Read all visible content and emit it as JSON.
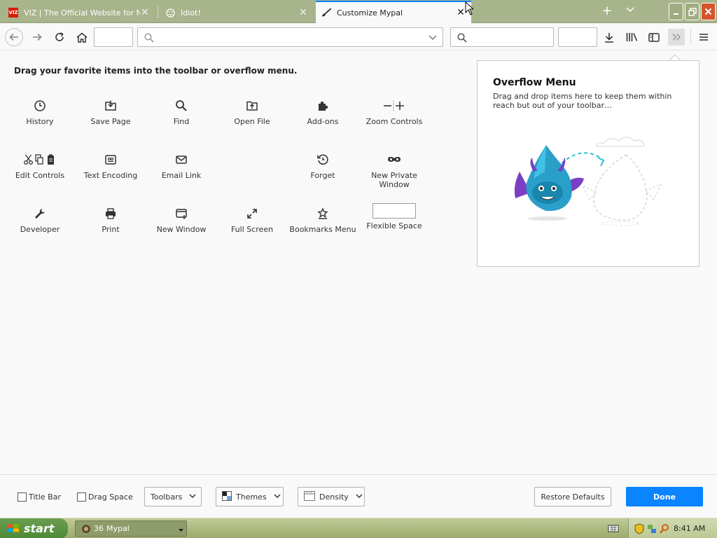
{
  "tabs": [
    {
      "title": "VIZ | The Official Website for Naruto",
      "favicon": "VIZ",
      "active": false
    },
    {
      "title": "Idiot!",
      "favicon": "smiley-icon",
      "active": false
    },
    {
      "title": "Customize Mypal",
      "favicon": "paintbrush-icon",
      "active": true
    }
  ],
  "toolbar": {
    "url_placeholder": "",
    "search_placeholder": ""
  },
  "instructions": "Drag your favorite items into the toolbar or overflow menu.",
  "palette": [
    {
      "label": "History",
      "icon": "clock-icon"
    },
    {
      "label": "Save Page",
      "icon": "save-page-icon"
    },
    {
      "label": "Find",
      "icon": "search-icon"
    },
    {
      "label": "Open File",
      "icon": "open-file-icon"
    },
    {
      "label": "Add-ons",
      "icon": "puzzle-icon"
    },
    {
      "label": "Zoom Controls",
      "icon": "zoom-icon"
    },
    {
      "label": "Edit Controls",
      "icon": "edit-controls-icon"
    },
    {
      "label": "Text Encoding",
      "icon": "text-encoding-icon"
    },
    {
      "label": "Email Link",
      "icon": "email-icon"
    },
    {
      "label": "Forget",
      "icon": "forget-icon"
    },
    {
      "label": "New Private Window",
      "icon": "private-window-icon"
    },
    {
      "label": "Developer",
      "icon": "wrench-icon"
    },
    {
      "label": "Print",
      "icon": "print-icon"
    },
    {
      "label": "New Window",
      "icon": "new-window-icon"
    },
    {
      "label": "Full Screen",
      "icon": "fullscreen-icon"
    },
    {
      "label": "Bookmarks Menu",
      "icon": "bookmarks-menu-icon"
    },
    {
      "label": "Flexible Space",
      "icon": "flexible-space"
    }
  ],
  "overflow": {
    "title": "Overflow Menu",
    "description": "Drag and drop items here to keep them within reach but out of your toolbar…"
  },
  "footer": {
    "title_bar_label": "Title Bar",
    "drag_space_label": "Drag Space",
    "toolbars_label": "Toolbars",
    "themes_label": "Themes",
    "density_label": "Density",
    "restore_label": "Restore Defaults",
    "done_label": "Done"
  },
  "taskbar": {
    "start_label": "start",
    "task_count": "36",
    "task_label": "Mypal",
    "clock": "8:41 AM"
  },
  "colors": {
    "accent": "#0a84ff",
    "tabbar": "#a8b48c",
    "close": "#d7532e"
  }
}
